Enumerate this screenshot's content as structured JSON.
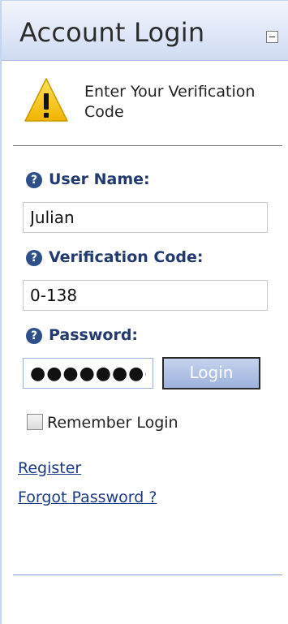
{
  "header": {
    "title": "Account Login"
  },
  "notice": {
    "text": "Enter Your Verification Code"
  },
  "form": {
    "username": {
      "label": "User Name:",
      "value": "Julian"
    },
    "verification": {
      "label": "Verification Code:",
      "value": "0-138"
    },
    "password": {
      "label": "Password:",
      "masked_value": "●●●●●●●●●"
    },
    "login_button": "Login",
    "remember_label": "Remember Login",
    "remember_checked": false
  },
  "links": {
    "register": "Register",
    "forgot": "Forgot Password ?"
  },
  "help_glyph": "?",
  "colors": {
    "accent": "#233a6e",
    "header_bg": "#dfe7f7",
    "link": "#1c3b86",
    "warning": "#f2c200"
  }
}
